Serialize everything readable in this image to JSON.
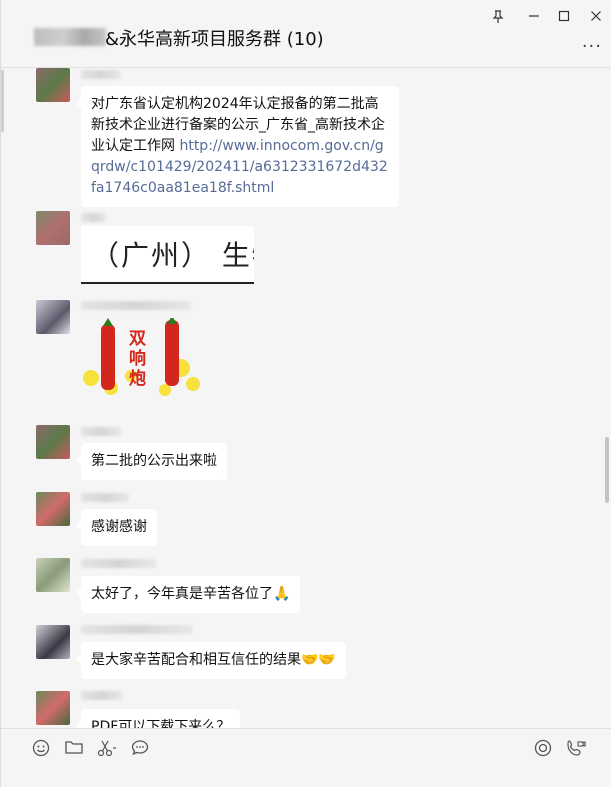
{
  "window": {
    "title": "&永华高新项目服务群 (10)",
    "pin_icon": "pin-icon",
    "minimize_icon": "minimize-icon",
    "maximize_icon": "maximize-icon",
    "close_icon": "close-icon",
    "more_label": "···"
  },
  "messages": [
    {
      "text_prefix": "对广东省认定机构2024年认定报备的第二批高新技术企业进行备案的公示_广东省_高新技术企业认定工作网 ",
      "link": "http://www.innocom.gov.cn/gqrdw/c101429/202411/a6312331672d432fa1746c0aa81ea18f.shtml"
    },
    {
      "image_text": "（广州） 生物"
    },
    {
      "sticker_text": "双响炮"
    },
    {
      "text": "第二批的公示出来啦"
    },
    {
      "text": "感谢感谢"
    },
    {
      "text": "太好了，今年真是辛苦各位了",
      "emoji": "🙏"
    },
    {
      "text": "是大家辛苦配合和相互信任的结果",
      "emoji": "🤝🤝"
    },
    {
      "text": "PDF可以下载下来么？"
    }
  ],
  "toolbar": {
    "emoji_icon": "smile-icon",
    "folder_icon": "folder-icon",
    "scissors_icon": "scissors-icon",
    "chat_icon": "chat-bubble-icon",
    "live_icon": "live-icon",
    "call_icon": "video-call-icon"
  },
  "colors": {
    "background": "#f5f5f5",
    "bubble": "#ffffff",
    "link": "#576b95"
  }
}
